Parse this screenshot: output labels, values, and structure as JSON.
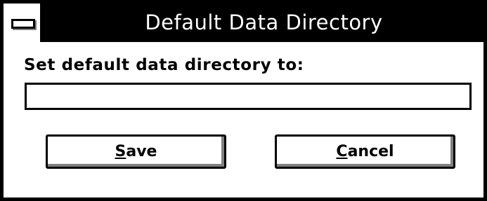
{
  "window": {
    "title": "Default Data Directory"
  },
  "form": {
    "prompt": "Set default data directory to:",
    "directory_value": ""
  },
  "buttons": {
    "save": {
      "mnemonic": "S",
      "rest": "ave"
    },
    "cancel": {
      "mnemonic": "C",
      "rest": "ancel"
    }
  },
  "icons": {
    "system_menu": "system-menu-icon"
  }
}
